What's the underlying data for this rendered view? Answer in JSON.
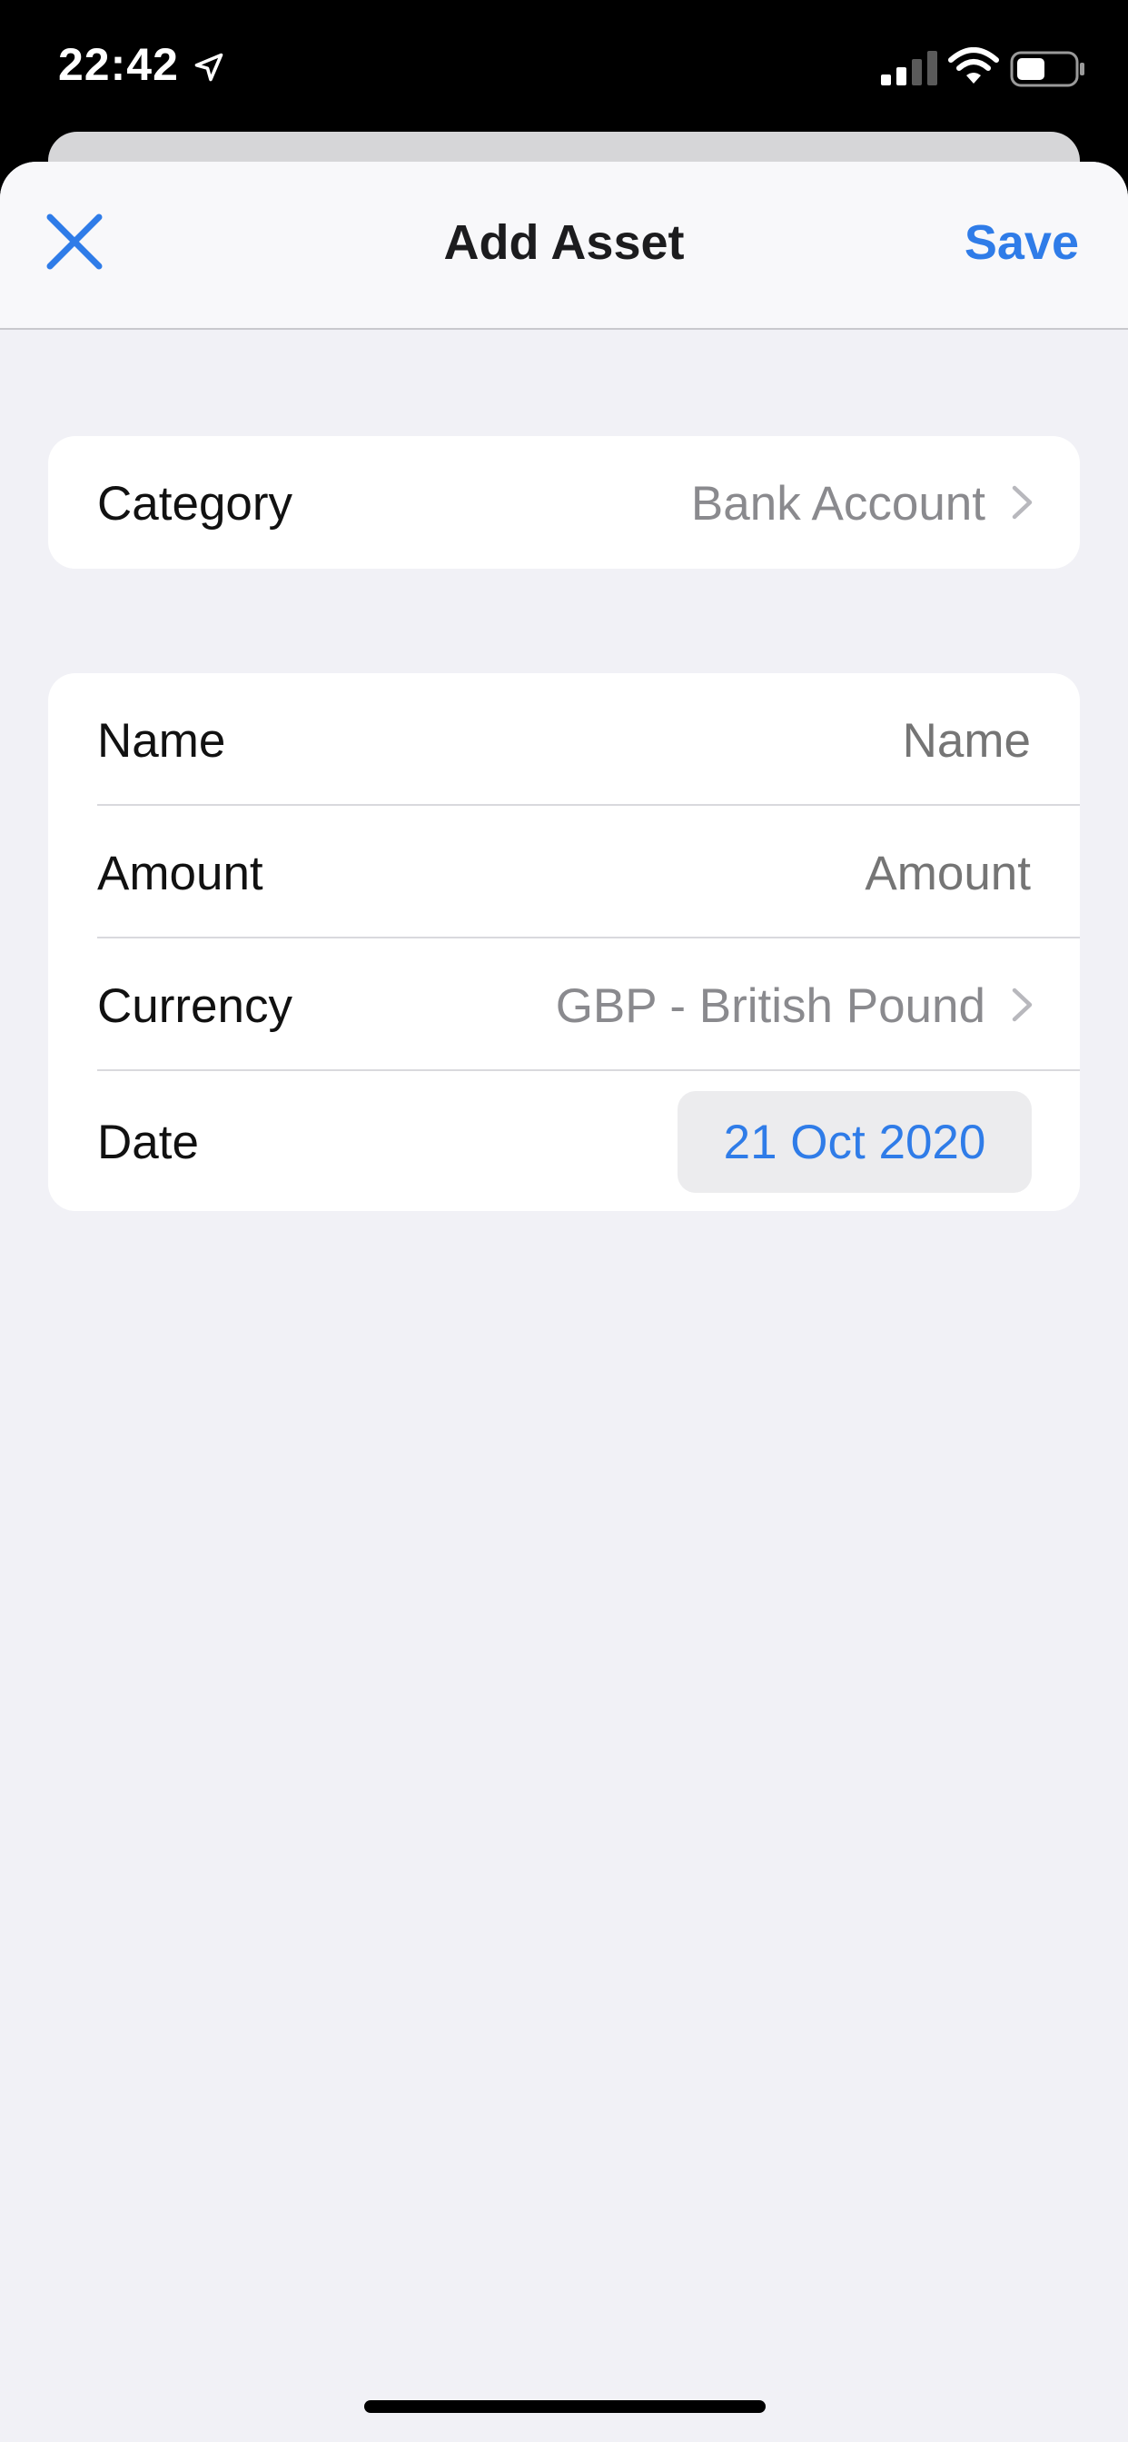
{
  "status_bar": {
    "time": "22:42",
    "icons": [
      "location-arrow-icon",
      "cellular-signal-icon",
      "wifi-icon",
      "battery-icon"
    ],
    "signal_bars_filled": 2,
    "signal_bars_total": 4,
    "battery_level": 0.4
  },
  "nav": {
    "title": "Add Asset",
    "close_icon": "close-x-icon",
    "save_label": "Save"
  },
  "form": {
    "category": {
      "label": "Category",
      "value": "Bank Account"
    },
    "name": {
      "label": "Name",
      "value": "",
      "placeholder": "Name"
    },
    "amount": {
      "label": "Amount",
      "value": "",
      "placeholder": "Amount"
    },
    "currency": {
      "label": "Currency",
      "value": "GBP - British Pound"
    },
    "date": {
      "label": "Date",
      "value": "21 Oct 2020"
    }
  },
  "colors": {
    "accent": "#2f7ce8",
    "background": "#f1f1f6",
    "card": "#ffffff",
    "secondary_text": "#8a8a8e",
    "placeholder_text": "#bebec3"
  }
}
